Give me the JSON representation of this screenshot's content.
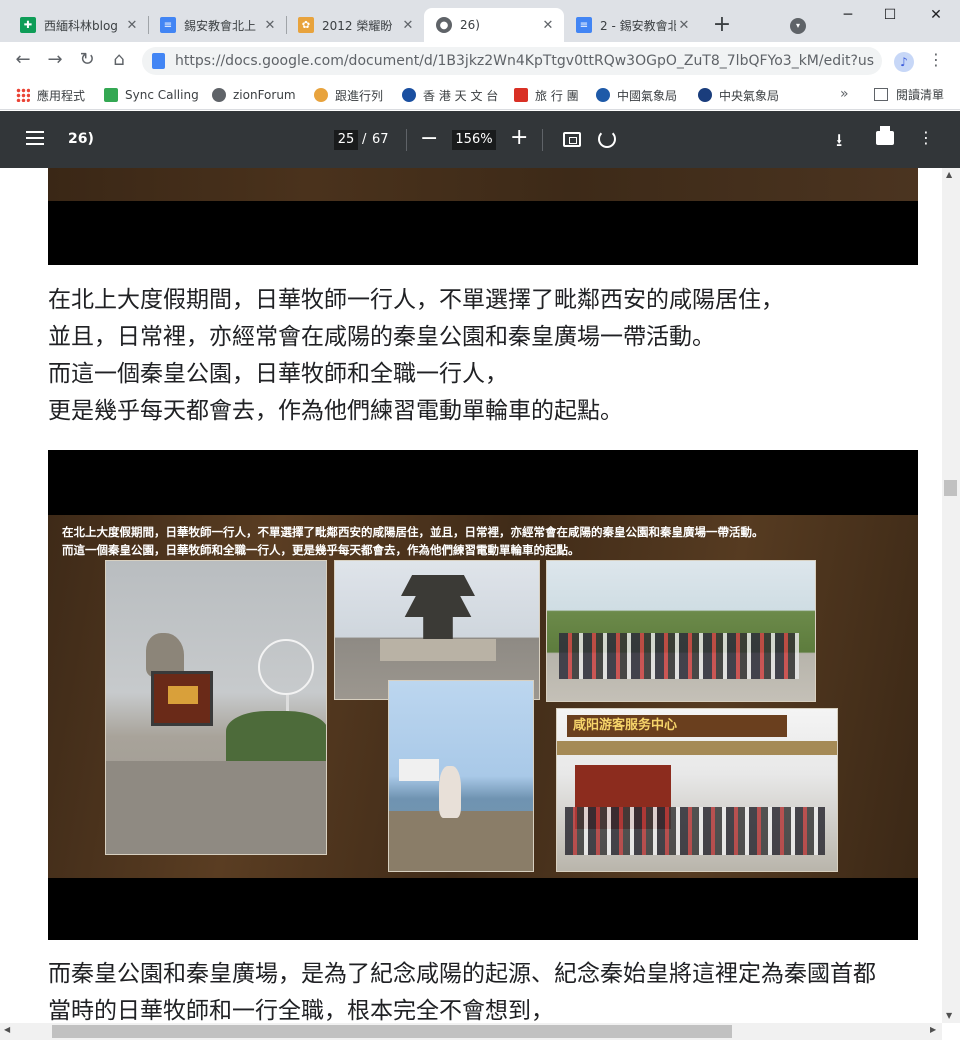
{
  "tabs": [
    {
      "label": "西緬科林blog",
      "close": "✕",
      "icon_color": "#0f9d58",
      "icon_glyph": "✚"
    },
    {
      "label": "錫安教會北上",
      "close": "✕",
      "icon_color": "#4285f4",
      "icon_glyph": "≡"
    },
    {
      "label": "2012 榮耀盼",
      "close": "✕",
      "icon_color": "#e8a33d",
      "icon_glyph": "✿"
    },
    {
      "label": "26)",
      "close": "✕",
      "icon_color": "#5f6368",
      "icon_glyph": "●"
    },
    {
      "label": "2 - 錫安教會北",
      "close": "✕",
      "icon_color": "#4285f4",
      "icon_glyph": "≡"
    }
  ],
  "window": {
    "new_tab": "+",
    "search_tabs": "▾",
    "minimize": "─",
    "maximize": "☐",
    "close": "✕"
  },
  "toolbar": {
    "back": "←",
    "forward": "→",
    "reload": "↻",
    "home": "⌂",
    "url": "https://docs.google.com/document/d/1B3jkz2Wn4KpTtgv0ttRQw3OGpO_ZuT8_7lbQFYo3_kM/edit?us...",
    "menu": "⋮",
    "profile_glyph": "♪"
  },
  "bookmarks": [
    {
      "label": "應用程式",
      "icon_color": "#ea4335"
    },
    {
      "label": "Sync Calling",
      "icon_color": "#34a853"
    },
    {
      "label": "zionForum",
      "icon_color": "#5f6368"
    },
    {
      "label": "跟進行列",
      "icon_color": "#e8a33d"
    },
    {
      "label": "香 港 天 文 台",
      "icon_color": "#1a4fa0"
    },
    {
      "label": "旅 行 團",
      "icon_color": "#d93025"
    },
    {
      "label": "中國氣象局",
      "icon_color": "#1e5aa8"
    },
    {
      "label": "中央氣象局",
      "icon_color": "#1a3d7c"
    }
  ],
  "bookmarks_more": "»",
  "reading_list": "閱讀清單",
  "pdf": {
    "title": "26)",
    "current_page": "25",
    "page_sep": "/",
    "total_pages": "67",
    "zoom_out": "−",
    "zoom": "156%",
    "zoom_in": "+",
    "download": "⭳",
    "more": "⋮"
  },
  "document": {
    "para1": [
      "在北上大度假期間，日華牧師一行人，不單選擇了毗鄰西安的咸陽居住，",
      "並且，日常裡，亦經常會在咸陽的秦皇公園和秦皇廣場一帶活動。",
      "而這一個秦皇公園，日華牧師和全職一行人，",
      "更是幾乎每天都會去，作為他們練習電動單輪車的起點。"
    ],
    "slide_caption_1": "在北上大度假期間，日華牧師一行人，不單選擇了毗鄰西安的咸陽居住，並且，日常裡，亦經常會在咸陽的秦皇公園和秦皇廣場一帶活動。",
    "slide_caption_2": "而這一個秦皇公園，日華牧師和全職一行人，更是幾乎每天都會去，作為他們練習電動單輪車的起點。",
    "photo_sign": "咸阳游客服务中心",
    "para2": [
      "而秦皇公園和秦皇廣場，是為了紀念咸陽的起源、紀念秦始皇將這裡定為秦國首都",
      "當時的日華牧師和一行全職，根本完全不會想到，"
    ]
  },
  "scroll": {
    "up": "▲",
    "down": "▼",
    "left": "◀",
    "right": "▶"
  }
}
